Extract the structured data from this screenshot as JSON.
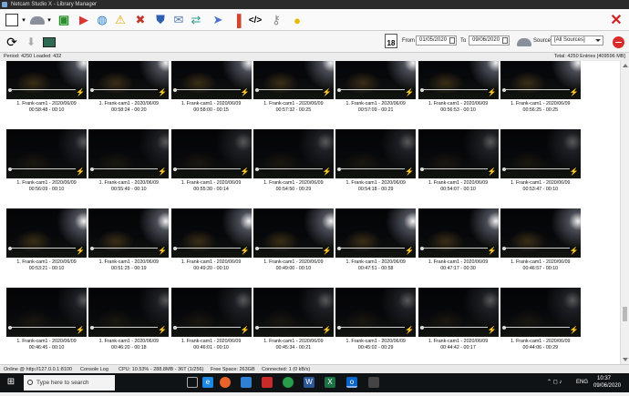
{
  "window": {
    "title": "Netcam Studio X - Library Manager"
  },
  "toolbar2": {
    "calendar_day": "18",
    "from_label": "From",
    "from_value": "01/05/2020",
    "to_label": "To",
    "to_value": "09/06/2020",
    "source_label": "Source",
    "source_value": "[All Sources]"
  },
  "status": {
    "period": "Period: 4250 Loaded: 432",
    "total": "Total: 4250 Entries [409596 MB]"
  },
  "clips": [
    [
      "1. Frank-cam1 - 2020/06/09",
      "00:58:48 - 00:10"
    ],
    [
      "1. Frank-cam1 - 2020/06/09",
      "00:58:24 - 00:20"
    ],
    [
      "1. Frank-cam1 - 2020/06/09",
      "00:58:00 - 00:15"
    ],
    [
      "1. Frank-cam1 - 2020/06/09",
      "00:57:32 - 00:25"
    ],
    [
      "1. Frank-cam1 - 2020/06/09",
      "00:57:09 - 00:21"
    ],
    [
      "1. Frank-cam1 - 2020/06/09",
      "00:56:53 - 00:10"
    ],
    [
      "1. Frank-cam1 - 2020/06/09",
      "00:56:25 - 00:25"
    ],
    [
      "1. Frank-cam1 - 2020/06/09",
      "00:56:09 - 00:10"
    ],
    [
      "1. Frank-cam1 - 2020/06/09",
      "00:55:49 - 00:10"
    ],
    [
      "1. Frank-cam1 - 2020/06/09",
      "00:55:30 - 00:14"
    ],
    [
      "1. Frank-cam1 - 2020/06/09",
      "00:54:50 - 00:29"
    ],
    [
      "1. Frank-cam1 - 2020/06/09",
      "00:54:18 - 00:29"
    ],
    [
      "1. Frank-cam1 - 2020/06/09",
      "00:54:07 - 00:10"
    ],
    [
      "1. Frank-cam1 - 2020/06/09",
      "00:53:47 - 00:10"
    ],
    [
      "1. Frank-cam1 - 2020/06/09",
      "00:53:21 - 00:10"
    ],
    [
      "1. Frank-cam1 - 2020/06/09",
      "00:51:25 - 00:19"
    ],
    [
      "1. Frank-cam1 - 2020/06/09",
      "00:49:20 - 00:10"
    ],
    [
      "1. Frank-cam1 - 2020/06/09",
      "00:49:00 - 00:10"
    ],
    [
      "1. Frank-cam1 - 2020/06/09",
      "00:47:51 - 00:58"
    ],
    [
      "1. Frank-cam1 - 2020/06/09",
      "00:47:17 - 00:30"
    ],
    [
      "1. Frank-cam1 - 2020/06/09",
      "00:46:57 - 00:10"
    ],
    [
      "1. Frank-cam1 - 2020/06/09",
      "00:46:45 - 00:10"
    ],
    [
      "1. Frank-cam1 - 2020/06/09",
      "00:46:20 - 00:18"
    ],
    [
      "1. Frank-cam1 - 2020/06/09",
      "00:46:01 - 00:10"
    ],
    [
      "1. Frank-cam1 - 2020/06/09",
      "00:45:34 - 00:21"
    ],
    [
      "1. Frank-cam1 - 2020/06/09",
      "00:45:02 - 00:29"
    ],
    [
      "1. Frank-cam1 - 2020/06/09",
      "00:44:42 - 00:17"
    ],
    [
      "1. Frank-cam1 - 2020/06/09",
      "00:44:06 - 00:29"
    ]
  ],
  "bottombar": {
    "online": "Online @ http://127.0.0.1:8100",
    "console": "Console Log",
    "cpu": "CPU: 10.53% - 288.8MB - 36T (1/256)",
    "free": "Free Space: 263GB",
    "connected": "Connected: 1 (0 kB/s)"
  },
  "taskbar": {
    "search_placeholder": "Type here to search",
    "lang": "ENG",
    "time": "10:37",
    "date": "09/06/2020"
  },
  "icons": {
    "folder": "folder-icon",
    "camera": "camera-icon",
    "globe": "globe-icon",
    "warning": "warning-icon",
    "tools": "tools-icon",
    "shield": "shield-icon",
    "mail": "mail-icon",
    "shuffle": "shuffle-icon",
    "send": "send-icon",
    "chart": "bar-chart-icon",
    "code": "code-icon",
    "key": "key-icon",
    "bulb": "lightbulb-icon",
    "close": "close-icon",
    "refresh": "refresh-icon",
    "download": "download-icon",
    "image": "image-icon",
    "minus": "minus-icon",
    "lightning": "lightning-icon"
  },
  "colors": {
    "close": "#d21f1f",
    "lightning": "#f2c200"
  }
}
